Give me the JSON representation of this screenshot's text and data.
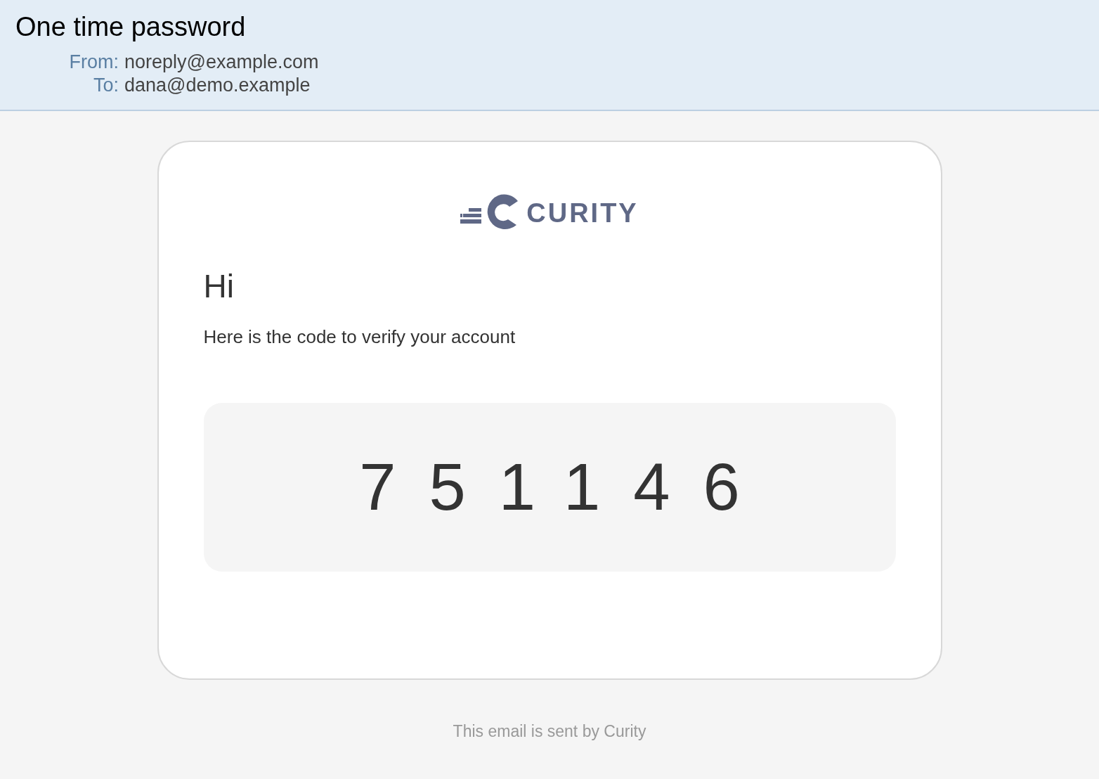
{
  "email": {
    "subject": "One time password",
    "headers": [
      {
        "label": "From:",
        "value": "noreply@example.com"
      },
      {
        "label": "To:",
        "value": "dana@demo.example"
      }
    ]
  },
  "message": {
    "brand": "CURITY",
    "greeting": "Hi",
    "intro": "Here is the code to verify your account",
    "code": "751146"
  },
  "footer": "This email is sent by Curity"
}
